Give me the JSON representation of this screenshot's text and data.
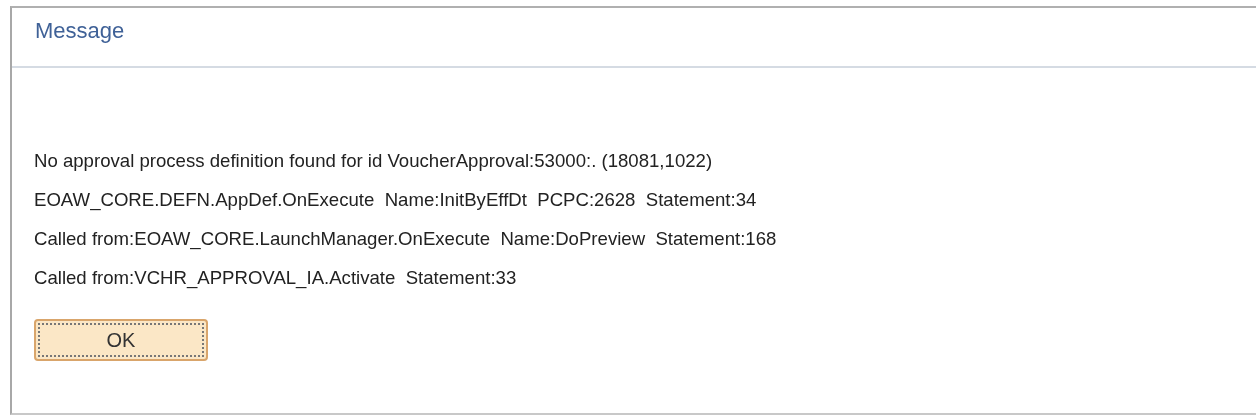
{
  "dialog": {
    "title": "Message",
    "lines": [
      "No approval process definition found for id VoucherApproval:53000:. (18081,1022)",
      "EOAW_CORE.DEFN.AppDef.OnExecute  Name:InitByEffDt  PCPC:2628  Statement:34",
      "Called from:EOAW_CORE.LaunchManager.OnExecute  Name:DoPreview  Statement:168",
      "Called from:VCHR_APPROVAL_IA.Activate  Statement:33"
    ],
    "buttons": [
      "OK"
    ]
  }
}
